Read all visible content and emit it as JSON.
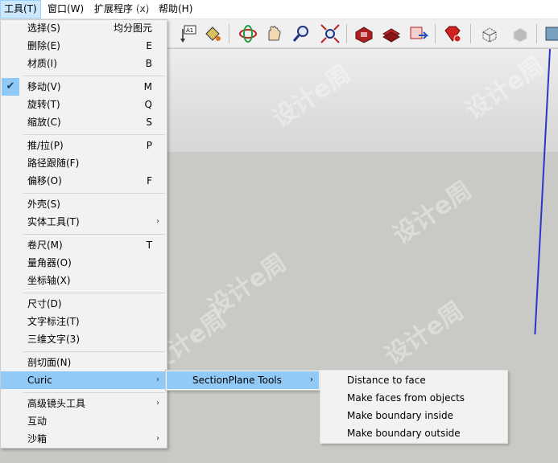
{
  "menubar": {
    "items": [
      "工具(T)",
      "窗口(W)",
      "扩展程序 (x)",
      "帮助(H)"
    ]
  },
  "toolbar": {
    "buttons": [
      "text-tag-icon",
      "paint-bucket-icon",
      "orbit-icon",
      "pan-hand-icon",
      "zoom-icon",
      "zoom-extents-icon",
      "warehouse-icon",
      "components-icon",
      "share-model-icon",
      "extension-warehouse-icon",
      "xray-icon",
      "wireframe-icon",
      "section-box-icon"
    ]
  },
  "menu": {
    "items": [
      {
        "label": "选择(S)",
        "shortcut": "均分图元"
      },
      {
        "label": "删除(E)",
        "shortcut": "E"
      },
      {
        "label": "材质(I)",
        "shortcut": "B"
      },
      {
        "label": "移动(V)",
        "shortcut": "M",
        "checked": true
      },
      {
        "label": "旋转(T)",
        "shortcut": "Q"
      },
      {
        "label": "缩放(C)",
        "shortcut": "S"
      },
      {
        "label": "推/拉(P)",
        "shortcut": "P"
      },
      {
        "label": "路径跟随(F)",
        "shortcut": ""
      },
      {
        "label": "偏移(O)",
        "shortcut": "F"
      },
      {
        "label": "外壳(S)",
        "shortcut": ""
      },
      {
        "label": "实体工具(T)",
        "shortcut": "",
        "submenu": true
      },
      {
        "label": "卷尺(M)",
        "shortcut": "T"
      },
      {
        "label": "量角器(O)",
        "shortcut": ""
      },
      {
        "label": "坐标轴(X)",
        "shortcut": ""
      },
      {
        "label": "尺寸(D)",
        "shortcut": ""
      },
      {
        "label": "文字标注(T)",
        "shortcut": ""
      },
      {
        "label": "三维文字(3)",
        "shortcut": ""
      },
      {
        "label": "剖切面(N)",
        "shortcut": ""
      },
      {
        "label": "Curic",
        "shortcut": "",
        "submenu": true,
        "highlighted": true
      },
      {
        "label": "高级镜头工具",
        "shortcut": "",
        "submenu": true
      },
      {
        "label": "互动",
        "shortcut": ""
      },
      {
        "label": "沙箱",
        "shortcut": "",
        "submenu": true
      }
    ]
  },
  "submenu_curic": {
    "items": [
      {
        "label": "SectionPlane Tools",
        "submenu": true,
        "highlighted": true
      }
    ]
  },
  "submenu_sectionplane": {
    "items": [
      {
        "label": "Distance to face"
      },
      {
        "label": "Make faces from objects"
      },
      {
        "label": "Make boundary inside"
      },
      {
        "label": "Make boundary outside"
      }
    ]
  },
  "watermark": "设计e周"
}
